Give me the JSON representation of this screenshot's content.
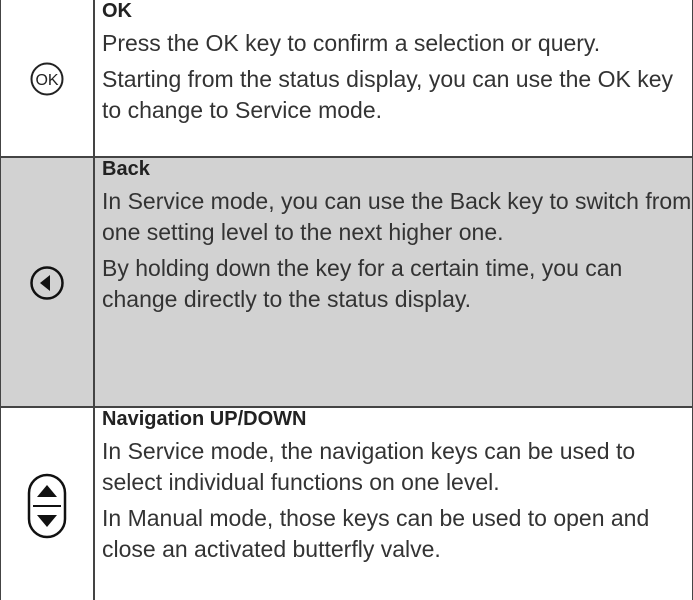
{
  "rows": [
    {
      "icon": "ok-key-icon",
      "title": "OK",
      "paragraphs": [
        "Press the OK key to confirm a selection or query.",
        "Starting from the status display, you can use the OK key to change to Service mode."
      ]
    },
    {
      "icon": "back-arrow-icon",
      "title": "Back",
      "paragraphs": [
        "In Service mode, you can use the Back key to switch from one setting level to the next higher one.",
        "By holding down the key for a certain time, you can change directly to the status display."
      ]
    },
    {
      "icon": "up-down-navigation-icon",
      "title": "Navigation UP/DOWN",
      "paragraphs": [
        "In Service mode, the navigation keys can be used to select individual functions on one level.",
        "In Manual mode, those keys can be used to open and close an activated butterfly valve."
      ]
    }
  ],
  "ok_icon_glyph": "OK",
  "colors": {
    "gray_row": "#d2d2d2",
    "border": "#444444",
    "text": "#333333"
  }
}
